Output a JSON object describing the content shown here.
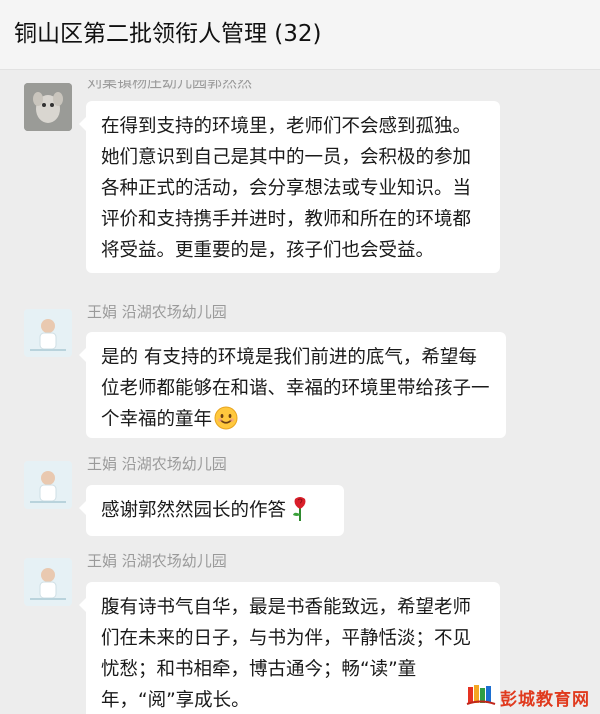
{
  "header": {
    "title": "铜山区第二批领衔人管理 (32)"
  },
  "messages": [
    {
      "sender": "刘集镇杨庄幼儿园郭然然",
      "avatar_icon": "user-photo-avatar",
      "text": "在得到支持的环境里，老师们不会感到孤独。她们意识到自己是其中的一员，会积极的参加各种正式的活动，会分享想法或专业知识。当评价和支持携手并进时，教师和所在的环境都将受益。更重要的是，孩子们也会受益。"
    },
    {
      "sender": "王娟 沿湖农场幼儿园",
      "avatar_icon": "baby-photo-avatar",
      "text": "是的  有支持的环境是我们前进的底气，希望每位老师都能够在和谐、幸福的环境里带给孩子一个幸福的童年",
      "emoji": "smile-emoji-icon"
    },
    {
      "sender": "王娟 沿湖农场幼儿园",
      "avatar_icon": "baby-photo-avatar",
      "text": "感谢郭然然园长的作答",
      "emoji": "rose-emoji-icon"
    },
    {
      "sender": "王娟 沿湖农场幼儿园",
      "avatar_icon": "baby-photo-avatar",
      "text": "腹有诗书气自华，最是书香能致远，希望老师们在未来的日子，与书为伴，平静恬淡；不见忧愁；和书相牵，博古通今；畅“读”童年，“阅”享成长。"
    }
  ],
  "watermark": {
    "text": "彭城教育网",
    "icon": "book-logo-icon"
  },
  "colors": {
    "background": "#ededed",
    "bubble": "#ffffff",
    "sender": "#9a9a9a",
    "watermark": "#e03a1e"
  }
}
